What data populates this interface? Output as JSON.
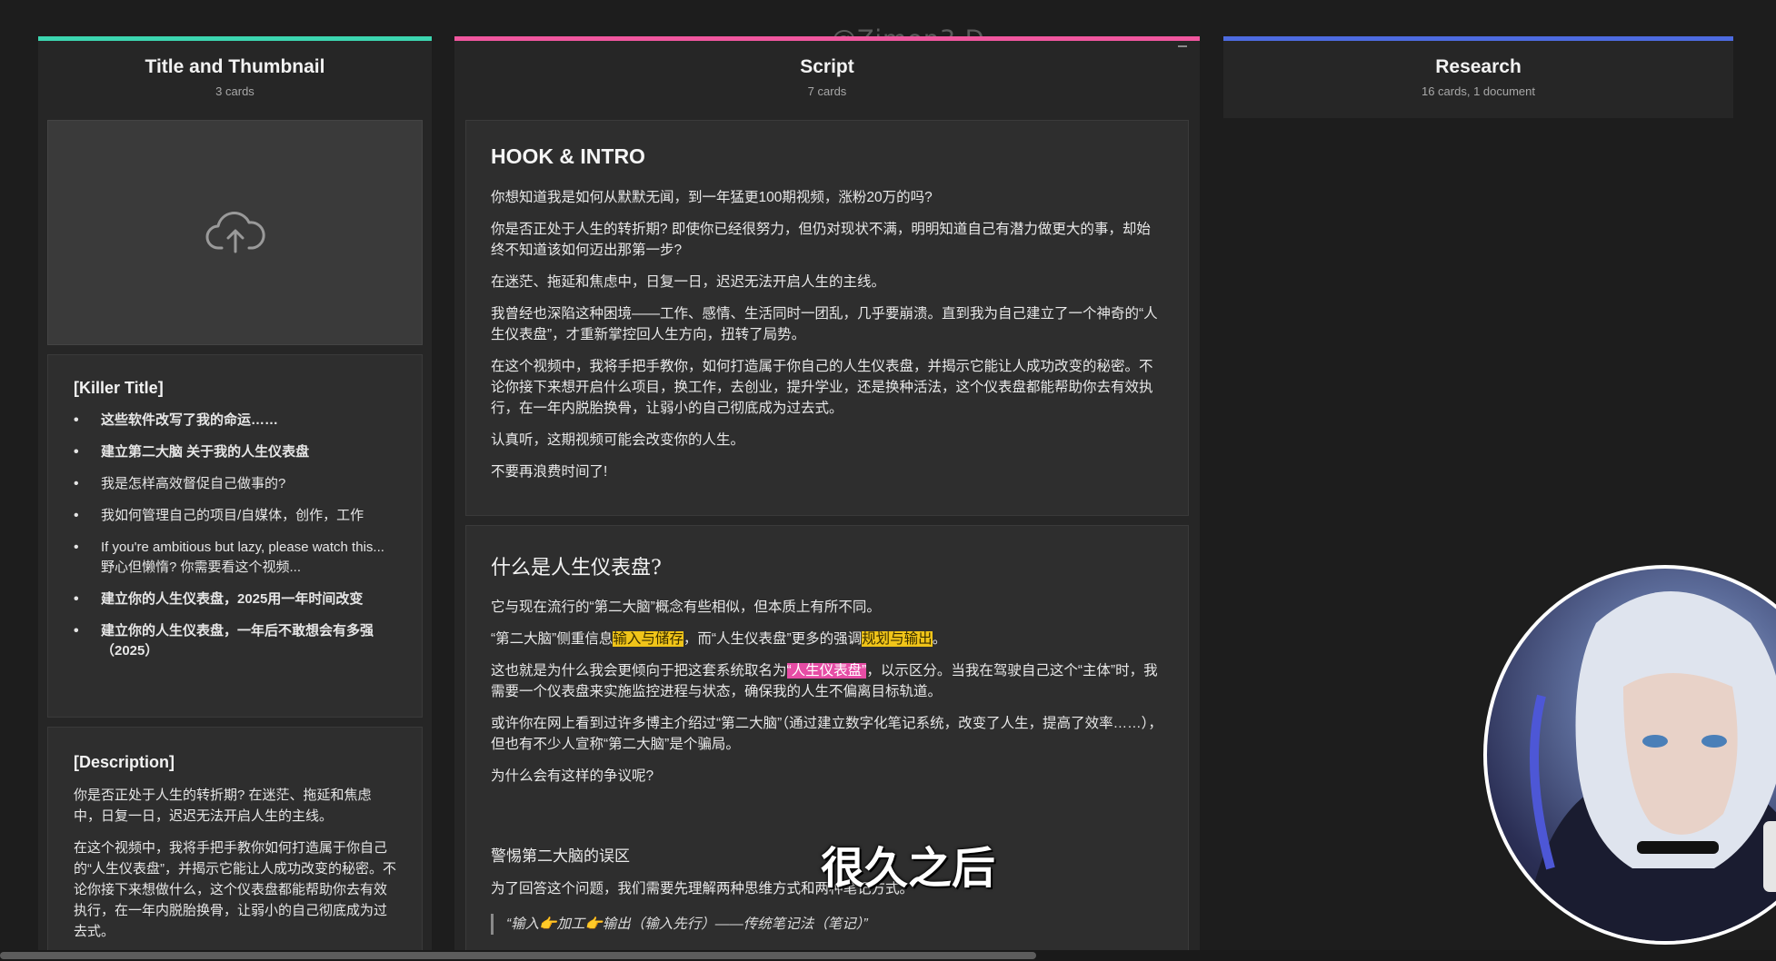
{
  "watermark": "@Zimon3·D",
  "columns": {
    "title_thumb": {
      "title": "Title and Thumbnail",
      "count": "3 cards",
      "accent": "#3cd6b0"
    },
    "script": {
      "title": "Script",
      "count": "7 cards",
      "accent": "#f0569e"
    },
    "research": {
      "title": "Research",
      "count": "16 cards, 1 document",
      "accent": "#4d6be0"
    }
  },
  "thumbnail": {
    "icon": "cloud-upload-icon"
  },
  "killer": {
    "heading": "[Killer Title]",
    "items": [
      {
        "text": "这些软件改写了我的命运……",
        "bold": true
      },
      {
        "text": "建立第二大脑 关于我的人生仪表盘",
        "bold": true
      },
      {
        "text": "我是怎样高效督促自己做事的?",
        "bold": false
      },
      {
        "text": "我如何管理自己的项目/自媒体，创作，工作",
        "bold": false
      },
      {
        "text": "If you're ambitious but lazy, please watch this...",
        "sub": "野心但懒惰? 你需要看这个视频...",
        "bold": false
      },
      {
        "text": "建立你的人生仪表盘，2025用一年时间改变",
        "bold": true
      },
      {
        "text": "建立你的人生仪表盘，一年后不敢想会有多强（2025）",
        "bold": true
      }
    ]
  },
  "description": {
    "heading": "[Description]",
    "paragraphs": [
      "你是否正处于人生的转折期? 在迷茫、拖延和焦虑中，日复一日，迟迟无法开启人生的主线。",
      "在这个视频中，我将手把手教你如何打造属于你自己的“人生仪表盘”，并揭示它能让人成功改变的秘密。不论你接下来想做什么，这个仪表盘都能帮助你去有效执行，在一年内脱胎换骨，让弱小的自己彻底成为过去式。"
    ]
  },
  "hook": {
    "heading": "HOOK & INTRO",
    "paragraphs": [
      "你想知道我是如何从默默无闻，到一年猛更100期视频，涨粉20万的吗?",
      "你是否正处于人生的转折期? 即使你已经很努力，但仍对现状不满，明明知道自己有潜力做更大的事，却始终不知道该如何迈出那第一步?",
      "在迷茫、拖延和焦虑中，日复一日，迟迟无法开启人生的主线。",
      "我曾经也深陷这种困境——工作、感情、生活同时一团乱，几乎要崩溃。直到我为自己建立了一个神奇的“人生仪表盘”，才重新掌控回人生方向，扭转了局势。",
      "在这个视频中，我将手把手教你，如何打造属于你自己的人生仪表盘，并揭示它能让人成功改变的秘密。不论你接下来想开启什么项目，换工作，去创业，提升学业，还是换种活法，这个仪表盘都能帮助你去有效执行，在一年内脱胎换骨，让弱小的自己彻底成为过去式。",
      "认真听，这期视频可能会改变你的人生。",
      "不要再浪费时间了!"
    ]
  },
  "whatis": {
    "heading": "什么是人生仪表盘?",
    "p1": "它与现在流行的“第二大脑”概念有些相似，但本质上有所不同。",
    "p2_a": "“第二大脑”侧重信息",
    "p2_hl1": "输入与储存",
    "p2_b": "，而“人生仪表盘”更多的强调",
    "p2_hl2": "规划与输出",
    "p2_c": "。",
    "p3_a": "这也就是为什么我会更倾向于把这套系统取名为",
    "p3_hl": "“人生仪表盘”",
    "p3_b": "，以示区分。当我在驾驶自己这个“主体”时，我需要一个仪表盘来实施监控进程与状态，确保我的人生不偏离目标轨道。",
    "p4": "或许你在网上看到过许多博主介绍过“第二大脑”（通过建立数字化笔记系统，改变了人生，提高了效率……），但也有不少人宣称“第二大脑”是个骗局。",
    "p5": "为什么会有这样的争议呢?",
    "sub_heading": "警惕第二大脑的误区",
    "p6": "为了回答这个问题，我们需要先理解两种思维方式和两种笔记方式。",
    "quote": "“输入👉加工👉输出（输入先行）——传统笔记法（笔记）”"
  },
  "subtitle": "很久之后",
  "colors": {
    "background": "#1d1d1d",
    "column": "#262626",
    "card": "#2e2e2e",
    "highlight_yellow": "#f0c419",
    "highlight_pink": "#e64da5"
  }
}
